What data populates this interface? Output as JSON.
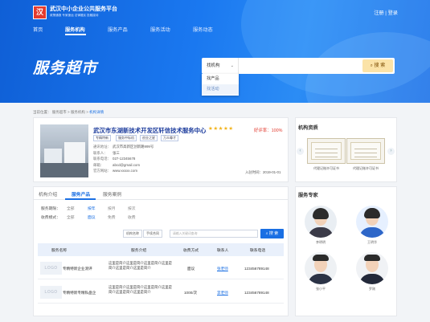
{
  "site": {
    "logo_text": "汉",
    "title": "武汉中小企业公共服务平台",
    "subtitle": "政策通报 专家速运 法律援民 投融接待",
    "auth": "注册 | 登录"
  },
  "nav": {
    "items": [
      "首页",
      "服务机构",
      "服务产品",
      "服务活动",
      "服务动态"
    ],
    "active": "服务机构"
  },
  "hero": {
    "title": "服务超市",
    "search": {
      "selected": "找机构",
      "placeholder": "",
      "button": "搜 索",
      "options": [
        "找产品",
        "找活动"
      ]
    }
  },
  "breadcrumb": {
    "label": "当前位置：",
    "items": [
      "服务超市",
      "服务机构"
    ],
    "current": "机构详情",
    "separator": ">"
  },
  "org": {
    "name": "武汉市东湖新技术开发区轩信技术服务中心",
    "stars": 5,
    "stars_text": "★★★★★",
    "rating_label": "好评率：",
    "rating_value": "100%",
    "tags": [
      "专精特新",
      "服务中标机",
      "创业之星",
      "万众尊才"
    ],
    "info": [
      {
        "k": "通讯地址：",
        "v": "武汉市高新区创新路999号"
      },
      {
        "k": "联系人：",
        "v": "张三"
      },
      {
        "k": "联系电话：",
        "v": "027-12345678"
      },
      {
        "k": "邮箱：",
        "v": "abcd@gmail.com"
      },
      {
        "k": "官方网站：",
        "v": "www.xxxxx.com"
      }
    ],
    "join_label": "入驻时间：",
    "join_date": "2019-01-01"
  },
  "resources": {
    "title": "机构资质",
    "certs": [
      {
        "caption": "代理记账许可证书"
      },
      {
        "caption": "代理记账许可证书"
      }
    ]
  },
  "tabs": {
    "items": [
      "机构介绍",
      "服务产品",
      "服务案例"
    ],
    "active": "服务产品"
  },
  "filters": {
    "period": {
      "label": "服务期限：",
      "options": [
        "全部",
        "按年",
        "按月",
        "按次"
      ],
      "active": "按年"
    },
    "fee": {
      "label": "收费模式：",
      "options": [
        "全部",
        "面议",
        "免费",
        "收费"
      ],
      "active": "面议"
    }
  },
  "product_search": {
    "segments": [
      "机构名称",
      "手续合同"
    ],
    "placeholder": "请输入关键词查询",
    "button": "搜 索"
  },
  "table": {
    "headers": [
      "服务名称",
      "服务介绍",
      "收费方式",
      "联系人",
      "联系电话"
    ],
    "rows": [
      {
        "logo": "LOGO",
        "name": "专精特新企业测评",
        "desc": "这里是简介这里是简介这里是简介这里是简介这里是简介这里是简介",
        "fee": "面议",
        "contact": "张老师",
        "phone": "123456789148"
      },
      {
        "logo": "LOGO",
        "name": "专精特新专精私盘企",
        "desc": "这里是简介这里是简介这里是简介这里是简介这里是简介这里是简介",
        "fee": "1000/次",
        "contact": "李老师",
        "phone": "123456789148"
      }
    ]
  },
  "experts": {
    "title": "服务专家",
    "people": [
      {
        "name": "李明明"
      },
      {
        "name": "王明华"
      },
      {
        "name": "张小平"
      },
      {
        "name": "罗刚"
      }
    ]
  },
  "colors": {
    "hero_blue": "#1a78f0",
    "accent_blue": "#1a6fe3",
    "rating_red": "#e23a2e",
    "search_btn": "#fbe3a8",
    "star_gold": "#f2b31b"
  }
}
